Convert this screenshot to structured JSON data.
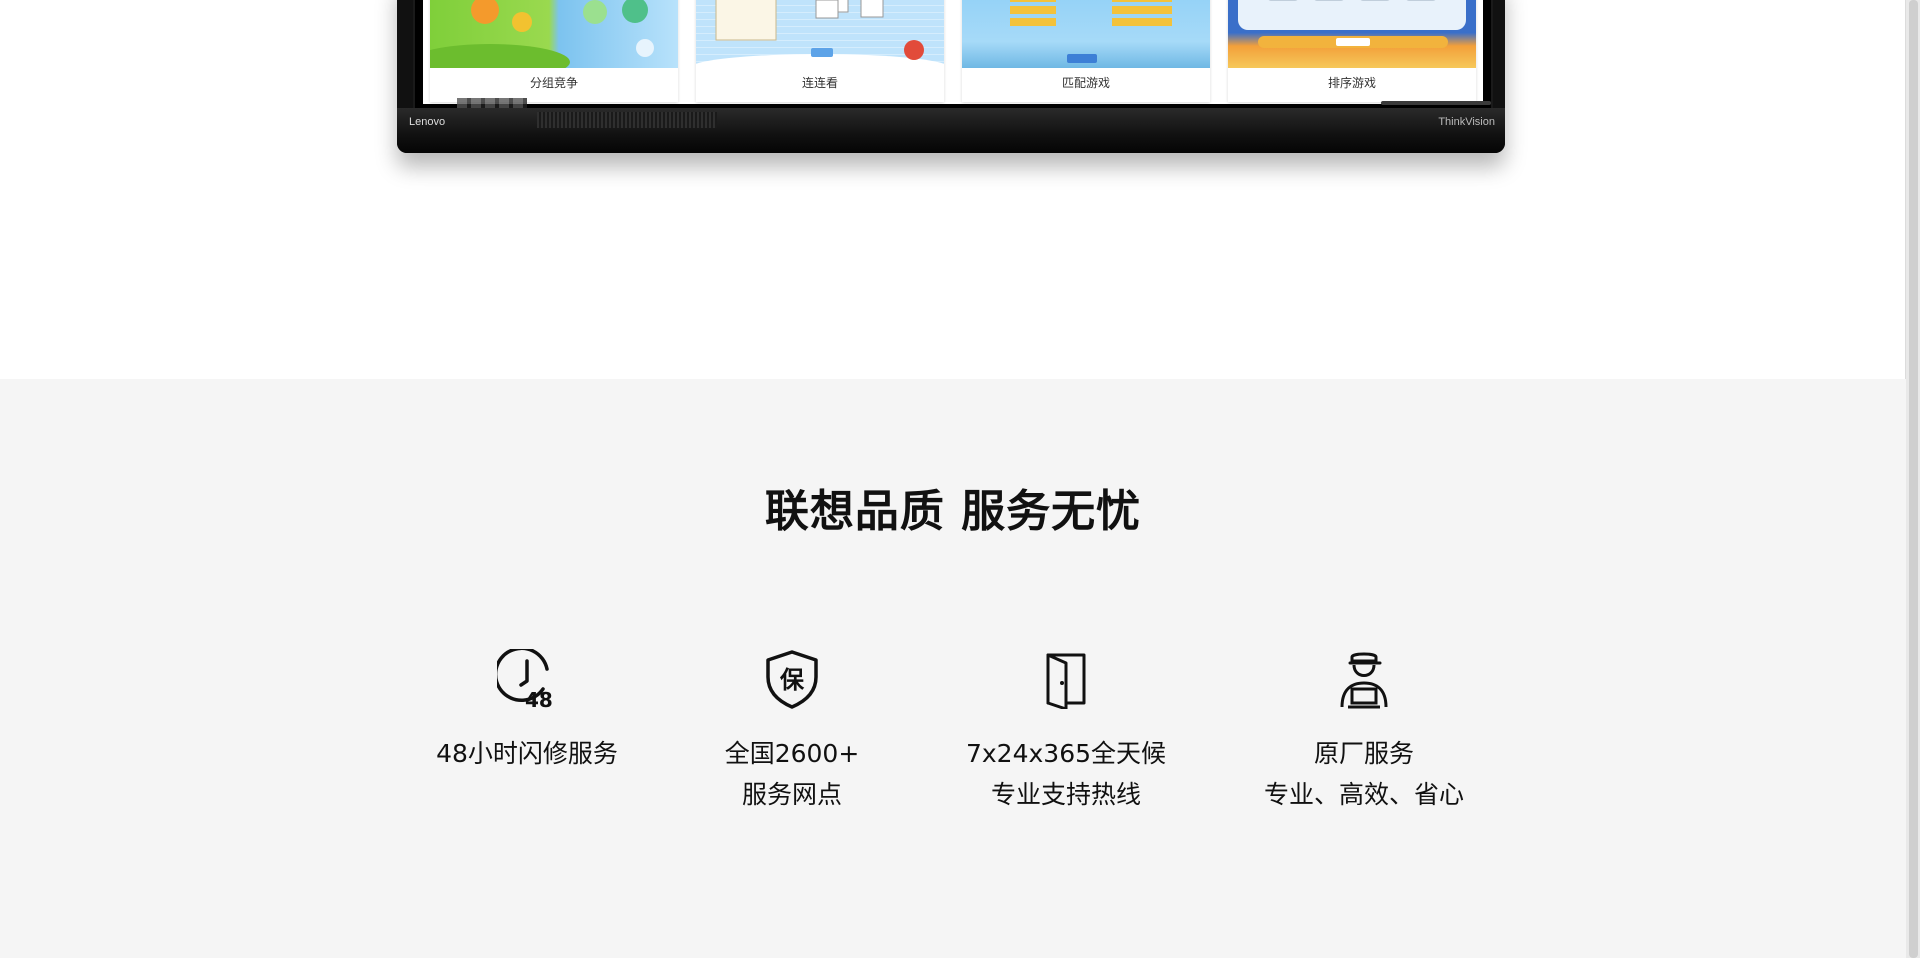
{
  "device": {
    "brand_left": "Lenovo",
    "brand_right": "ThinkVision",
    "games": [
      {
        "label": "分组竞争"
      },
      {
        "label": "连连看"
      },
      {
        "label": "匹配游戏"
      },
      {
        "label": "排序游戏"
      }
    ]
  },
  "service": {
    "title": "联想品质 服务无忧",
    "features": [
      {
        "icon": "clock-48-icon",
        "line1": "48小时闪修服务",
        "line2": ""
      },
      {
        "icon": "shield-bao-icon",
        "line1": "全国2600+",
        "line2": "服务网点"
      },
      {
        "icon": "door-icon",
        "line1": "7x24x365全天候",
        "line2": "专业支持热线"
      },
      {
        "icon": "technician-icon",
        "line1": "原厂服务",
        "line2": "专业、高效、省心"
      }
    ]
  }
}
